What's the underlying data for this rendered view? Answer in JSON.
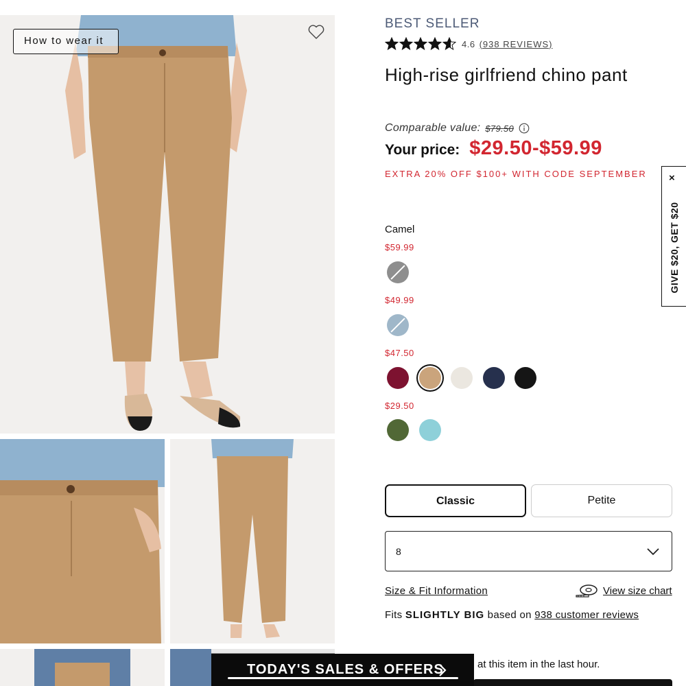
{
  "gallery": {
    "how_to_wear": "How to wear it"
  },
  "product": {
    "badge": "BEST SELLER",
    "rating": "4.6",
    "stars_filled": 4.6,
    "reviews_link": "(938 REVIEWS)",
    "title": "High-rise girlfriend chino pant",
    "comparable_label": "Comparable value:",
    "comparable_price": "$79.50",
    "your_price_label": "Your price:",
    "price_range": "$29.50-$59.99",
    "promo": "EXTRA 20% OFF $100+ WITH CODE SEPTEMBER"
  },
  "colors": {
    "selected_name": "Camel",
    "tiers": [
      {
        "price": "$59.99",
        "swatches": [
          {
            "name": "gray-heather",
            "hex": "#8e8e8e",
            "pattern": "striped"
          }
        ]
      },
      {
        "price": "$49.99",
        "swatches": [
          {
            "name": "light-blue",
            "hex": "#9fb7c9",
            "pattern": "striped"
          }
        ]
      },
      {
        "price": "$47.50",
        "swatches": [
          {
            "name": "burgundy",
            "hex": "#7d1230"
          },
          {
            "name": "camel",
            "hex": "#caa47c",
            "selected": true
          },
          {
            "name": "ivory",
            "hex": "#ebe7e0"
          },
          {
            "name": "navy",
            "hex": "#26304d"
          },
          {
            "name": "black",
            "hex": "#151515"
          }
        ]
      },
      {
        "price": "$29.50",
        "swatches": [
          {
            "name": "olive",
            "hex": "#516836"
          },
          {
            "name": "aqua",
            "hex": "#8ed0d9"
          }
        ]
      }
    ]
  },
  "fit": {
    "options": [
      "Classic",
      "Petite"
    ],
    "selected": "Classic"
  },
  "size": {
    "value": "8",
    "size_fit_link": "Size & Fit Information",
    "view_chart_link": "View size chart"
  },
  "fits": {
    "prefix": "Fits",
    "emphasis": "SLIGHTLY BIG",
    "middle": "based on",
    "link": "938 customer reviews"
  },
  "activity": {
    "text": "at this item in the last hour."
  },
  "banner": {
    "label": "TODAY'S SALES & OFFERS"
  },
  "referral": {
    "label": "GIVE $20, GET $20",
    "close": "×"
  },
  "theme": {
    "sale_red": "#d22630",
    "badge_blue": "#4c5a76",
    "khaki": "#c49a6c"
  }
}
